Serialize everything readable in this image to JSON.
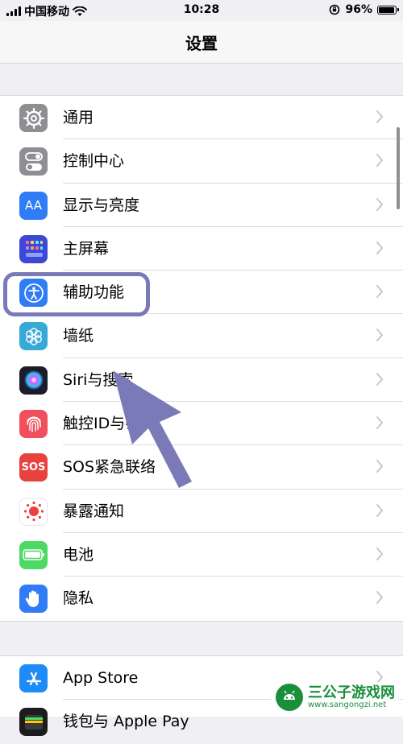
{
  "status_bar": {
    "carrier": "中国移动",
    "time": "10:28",
    "battery": "96%",
    "battery_level": 0.96
  },
  "nav": {
    "title": "设置"
  },
  "settings_group_1": [
    {
      "label": "通用",
      "icon": "gear-icon",
      "color": "#8e8e93"
    },
    {
      "label": "控制中心",
      "icon": "toggle-icon",
      "color": "#8e8e93"
    },
    {
      "label": "显示与亮度",
      "icon": "text-size-icon",
      "icon_text": "AA",
      "color": "#2f7cf6"
    },
    {
      "label": "主屏幕",
      "icon": "home-grid-icon",
      "color": "#3b49d6"
    },
    {
      "label": "辅助功能",
      "icon": "accessibility-icon",
      "color": "#2f7cf6"
    },
    {
      "label": "墙纸",
      "icon": "flower-icon",
      "color": "#36a9d6"
    },
    {
      "label": "Siri与搜索",
      "icon": "siri-icon",
      "color": "#1c1c2e"
    },
    {
      "label": "触控ID与密码",
      "icon": "fingerprint-icon",
      "color": "#f04f5b"
    },
    {
      "label": "SOS紧急联络",
      "icon": "sos-icon",
      "icon_text": "SOS",
      "color": "#e8423f"
    },
    {
      "label": "暴露通知",
      "icon": "exposure-icon",
      "color": "#ffffff"
    },
    {
      "label": "电池",
      "icon": "battery-icon",
      "color": "#4cd964"
    },
    {
      "label": "隐私",
      "icon": "hand-icon",
      "color": "#2f7cf6"
    }
  ],
  "settings_group_2": [
    {
      "label": "App Store",
      "icon": "app-store-icon",
      "color": "#1d8cf8"
    },
    {
      "label": "钱包与 Apple Pay",
      "icon": "wallet-icon",
      "color": "#1c1c1e"
    }
  ],
  "watermark": {
    "name": "三公子游戏网",
    "url": "www.sangongzi.net",
    "color": "#1a8f3a"
  }
}
